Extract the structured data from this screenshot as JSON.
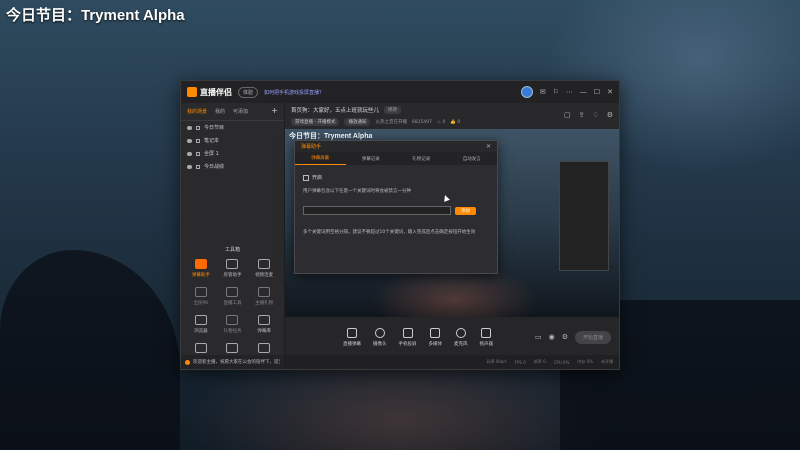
{
  "overlay_title": "今日节目：Tryment Alpha",
  "app": {
    "name": "直播伴侣",
    "version": "体验",
    "notice": "如何把手机游戏投屏直播？",
    "window_controls": [
      "⋯",
      "—",
      "☐",
      "✕"
    ]
  },
  "sidebar": {
    "tabs": [
      {
        "label": "我的场景",
        "active": true
      },
      {
        "label": "我的",
        "active": false
      },
      {
        "label": "可添加",
        "active": false
      }
    ],
    "plus": "+",
    "scenes": [
      "今日节目",
      "笔记本",
      "全屏 1",
      "今日战绩"
    ],
    "tools_title": "工具箱",
    "tools": [
      {
        "label": "弹幕助手",
        "state": "active"
      },
      {
        "label": "房管助手",
        "state": "normal"
      },
      {
        "label": "视频连麦",
        "state": "normal"
      },
      {
        "label": "全民PK",
        "state": "dim"
      },
      {
        "label": "直播工具",
        "state": "dim"
      },
      {
        "label": "主播礼物",
        "state": "dim"
      },
      {
        "label": "浏览器",
        "state": "normal"
      },
      {
        "label": "礼物任务",
        "state": "dim"
      },
      {
        "label": "弹幕库",
        "state": "normal"
      },
      {
        "label": "虚拟",
        "state": "normal"
      },
      {
        "label": "投票",
        "state": "normal"
      },
      {
        "label": "更多",
        "state": "normal"
      }
    ],
    "bottom_notice": "欢迎新主播，祝愿大家在公会的陪伴下，适当的直播节奏不宜勤奋"
  },
  "infobar": {
    "greeting": "首页狗：大家好，五点上班就玩些儿",
    "edit": "修改",
    "chips": [
      "游戏直播 - 开播模式",
      "播放通知"
    ],
    "stats": [
      "火热之音在开播",
      "6815497",
      "♨ 0",
      "👍 0"
    ]
  },
  "preview": {
    "title": "今日节目：Tryment Alpha"
  },
  "bottom_toolbar": {
    "buttons": [
      "直播弹幕",
      "摄像头",
      "手机投屏",
      "多媒体",
      "麦克风",
      "扬声器"
    ],
    "live_button": "开始直播"
  },
  "statusbar": [
    "码率 0kb/s",
    "FPS 0",
    "帧率 0",
    "CPU 0%",
    "内存 0%",
    "未开播"
  ],
  "dialog": {
    "title": "弹幕助手",
    "close": "✕",
    "tabs": [
      {
        "label": "弹幕屏蔽",
        "active": true
      },
      {
        "label": "弹幕记录",
        "active": false
      },
      {
        "label": "礼物记录",
        "active": false
      },
      {
        "label": "自动发言",
        "active": false
      }
    ],
    "checkbox_label": "开启",
    "description": "用户弹幕包含以下任意一个关键词时将会被禁言一分钟",
    "input_placeholder": "",
    "add_button": "添加",
    "note": "多个关键词用空格分隔，建议不要超过10个关键词，输入完成后点击确定按钮开始生效"
  }
}
